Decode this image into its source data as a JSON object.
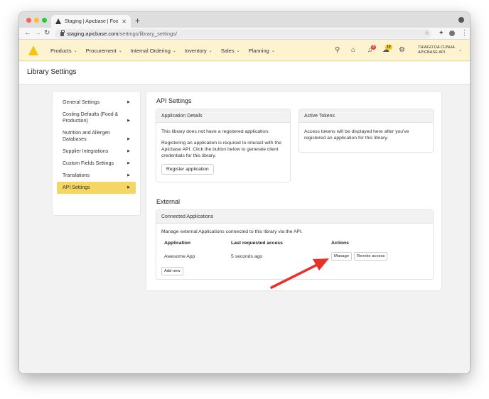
{
  "browser": {
    "tab_title": "Staging | Apicbase | Food and",
    "tab_close": "✕",
    "new_tab": "+",
    "url_host": "staging.apicbase.com",
    "url_path": "/settings/library_settings/",
    "back": "←",
    "forward": "→",
    "reload": "↻",
    "star": "☆",
    "extensions": "✦",
    "menu": "⋮"
  },
  "header": {
    "nav": [
      {
        "label": "Products"
      },
      {
        "label": "Procurement"
      },
      {
        "label": "Internal Ordering"
      },
      {
        "label": "Inventory"
      },
      {
        "label": "Sales"
      },
      {
        "label": "Planning"
      }
    ],
    "chevron": "⌄",
    "search_icon": "⚲",
    "basket_icon": "⌂",
    "bell_icon": "♫",
    "chef_icon": "☁",
    "gear_icon": "⚙",
    "notification_count": "3",
    "chef_count": "10",
    "user_name": "THIAGO DA CUNHA",
    "user_org": "APICBASE API",
    "user_chevron": "⌄"
  },
  "page": {
    "title": "Library Settings"
  },
  "sidebar": {
    "caret": "▶",
    "items": [
      {
        "label": "General Settings"
      },
      {
        "label": "Costing Defaults (Food & Production)"
      },
      {
        "label": "Nutrition and Allergen Databases"
      },
      {
        "label": "Supplier Integrations"
      },
      {
        "label": "Custom Fields Settings"
      },
      {
        "label": "Translations"
      },
      {
        "label": "API Settings"
      }
    ]
  },
  "api_settings": {
    "title": "API Settings",
    "details": {
      "heading": "Application Details",
      "line1": "This library does not have a registered application.",
      "line2": "Registering an application is required to interact with the Apicbase API. Click the button below to generate client credentials for this library.",
      "button": "Register application"
    },
    "tokens": {
      "heading": "Active Tokens",
      "text": "Access tokens will be displayed here after you've registered an application for this library."
    }
  },
  "external": {
    "title": "External",
    "heading": "Connected Applications",
    "description": "Manage external Applications connected to this library via the API.",
    "columns": {
      "application": "Application",
      "last_access": "Last requested access",
      "actions": "Actions"
    },
    "rows": [
      {
        "application": "Awesome App",
        "last_access": "5 seconds ago",
        "manage": "Manage",
        "revoke": "Revoke access"
      }
    ],
    "add_new": "Add new"
  },
  "colors": {
    "header_bg": "#fdf3cf",
    "brand_yellow": "#f3c316",
    "active_item": "#f5d664",
    "annotation_arrow": "#e8312a"
  }
}
